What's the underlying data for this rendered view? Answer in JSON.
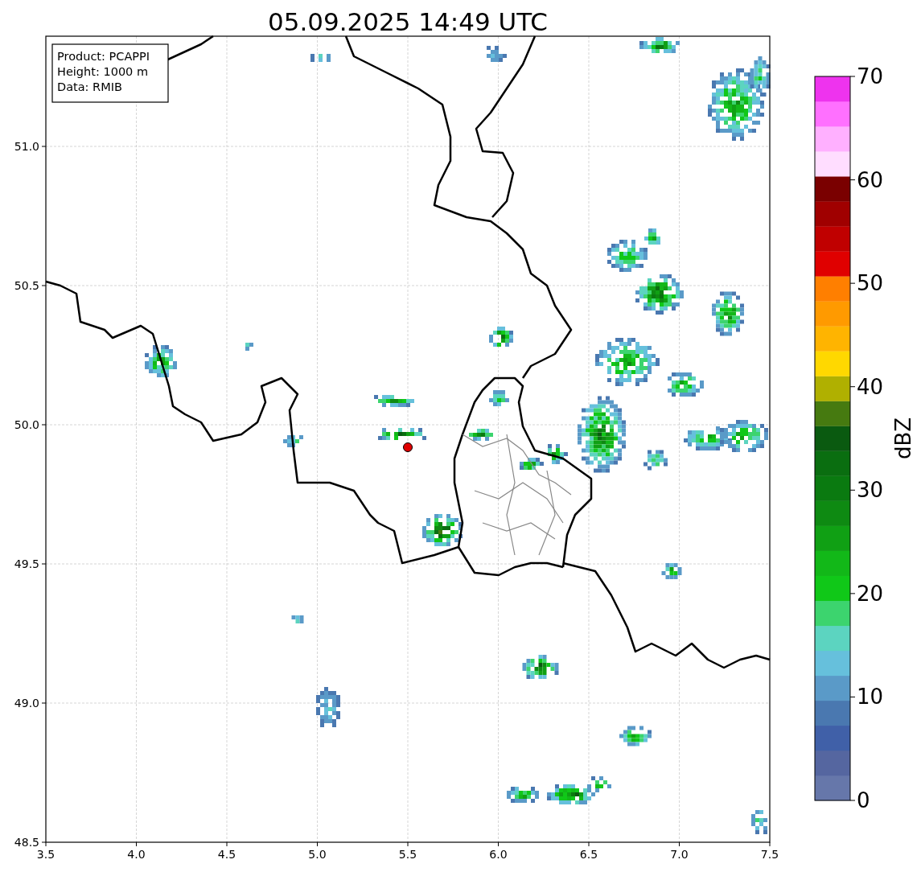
{
  "title": "05.09.2025 14:49 UTC",
  "info_box": [
    "Product: PCAPPI",
    "Height: 1000 m",
    "Data: RMIB"
  ],
  "x_axis": {
    "ticks": [
      "3.5",
      "4.0",
      "4.5",
      "5.0",
      "5.5",
      "6.0",
      "6.5",
      "7.0",
      "7.5"
    ]
  },
  "y_axis": {
    "ticks": [
      "51.0",
      "50.5",
      "50.0",
      "49.5",
      "49.0",
      "48.5"
    ]
  },
  "colorbar": {
    "label": "dBZ",
    "ticks": [
      "70",
      "60",
      "50",
      "40",
      "30",
      "20",
      "10",
      "0"
    ],
    "bands": [
      {
        "color": "#6677aa"
      },
      {
        "color": "#5566a0"
      },
      {
        "color": "#4060a8"
      },
      {
        "color": "#4a78b0"
      },
      {
        "color": "#5a9ac8"
      },
      {
        "color": "#66c0dc"
      },
      {
        "color": "#5cd4c0"
      },
      {
        "color": "#3cd46e"
      },
      {
        "color": "#10c818"
      },
      {
        "color": "#12b818"
      },
      {
        "color": "#10a014"
      },
      {
        "color": "#0e8a12"
      },
      {
        "color": "#0a7a10"
      },
      {
        "color": "#0a6e10"
      },
      {
        "color": "#0a5a10"
      },
      {
        "color": "#467a10"
      },
      {
        "color": "#b0b000"
      },
      {
        "color": "#ffd800"
      },
      {
        "color": "#ffb400"
      },
      {
        "color": "#ff9a00"
      },
      {
        "color": "#ff7f00"
      },
      {
        "color": "#e00000"
      },
      {
        "color": "#c00000"
      },
      {
        "color": "#a00000"
      },
      {
        "color": "#7a0000"
      },
      {
        "color": "#ffddff"
      },
      {
        "color": "#ffb0ff"
      },
      {
        "color": "#ff70ff"
      },
      {
        "color": "#ee33ee"
      }
    ]
  }
}
